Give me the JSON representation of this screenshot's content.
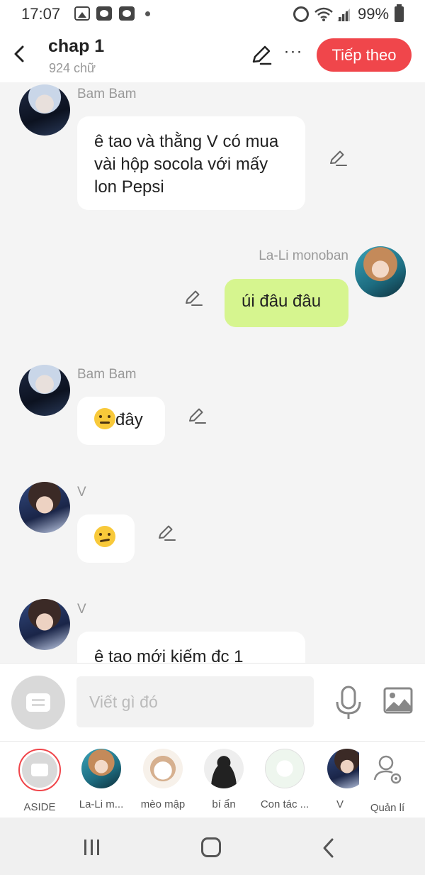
{
  "status_bar": {
    "time": "17:07",
    "battery": "99%"
  },
  "header": {
    "title": "chap 1",
    "word_count": "924 chữ",
    "next_label": "Tiếp theo",
    "more_label": "···"
  },
  "messages": [
    {
      "sender": "Bam Bam",
      "text": "ê tao và thằng V có mua vài hộp socola với mấy lon Pepsi",
      "side": "left"
    },
    {
      "sender": "La-Li monoban",
      "text": "úi đâu đâu",
      "side": "right"
    },
    {
      "sender": "Bam Bam",
      "text": "đây",
      "emoji": "expressionless-emoji",
      "side": "left"
    },
    {
      "sender": "V",
      "text": "",
      "emoji": "confused-emoji",
      "side": "left"
    },
    {
      "sender": "V",
      "text": "ê tao mới kiếm đc 1",
      "side": "left"
    }
  ],
  "composer": {
    "placeholder": "Viết gì đó"
  },
  "characters": [
    {
      "label": "ASIDE"
    },
    {
      "label": "La-Li m..."
    },
    {
      "label": "mèo mập"
    },
    {
      "label": "bí ẩn"
    },
    {
      "label": "Con tác ..."
    },
    {
      "label": "V"
    },
    {
      "label": "Quản lí"
    }
  ],
  "colors": {
    "accent": "#f0464b",
    "own_bubble": "#d6f58f",
    "other_bubble": "#ffffff",
    "background": "#f4f4f4"
  }
}
